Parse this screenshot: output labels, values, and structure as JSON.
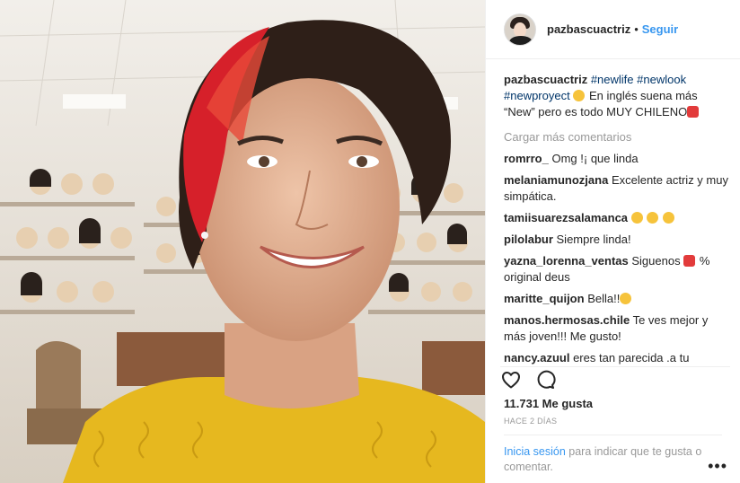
{
  "post": {
    "username": "pazbascuactriz",
    "follow_label": "Seguir",
    "separator": "•",
    "caption": {
      "username": "pazbascuactriz",
      "tags": [
        "#newlife",
        "#newlook",
        "#newproyect"
      ],
      "text": "En inglés suena más “New” pero es todo MUY CHILENO"
    },
    "load_more_label": "Cargar más comentarios",
    "comments": [
      {
        "user": "romrro_",
        "text": "Omg !¡ que linda"
      },
      {
        "user": "melaniamunozjana",
        "text": "Excelente actriz y muy simpática."
      },
      {
        "user": "tamiisuarezsalamanca",
        "text": ""
      },
      {
        "user": "pilolabur",
        "text": "Siempre linda!"
      },
      {
        "user": "yazna_lorenna_ventas",
        "text": "Siguenos",
        "text2": "% original deus"
      },
      {
        "user": "maritte_quijon",
        "text": "Bella!!"
      },
      {
        "user": "manos.hermosas.chile",
        "text": "Te ves mejor y más joven!!! Me gusto!"
      },
      {
        "user": "nancy.azuul",
        "text": "eres tan parecida .a tu abuelito nuestro grán presidente ..don Patricio alwiny"
      }
    ],
    "likes": "11.731 Me gusta",
    "time_ago": "HACE 2 DÍAS",
    "login_prompt": {
      "link": "Inicia sesión",
      "text": "para indicar que te gusta o comentar."
    },
    "more_label": "•••",
    "icons": {
      "like": "heart-icon",
      "comment": "comment-icon",
      "more": "more-options-icon"
    }
  }
}
